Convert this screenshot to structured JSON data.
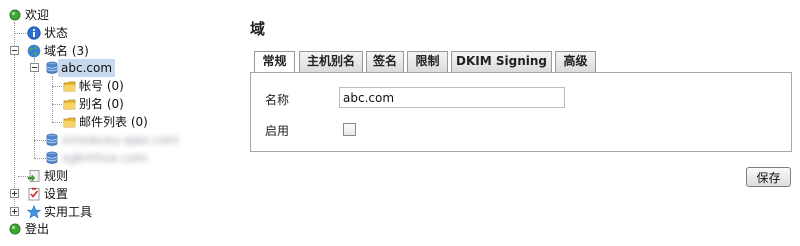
{
  "tree": {
    "welcome": "欢迎",
    "status": "状态",
    "domains": "域名 (3)",
    "selected_domain": "abc.com",
    "accounts": "帐号 (0)",
    "aliases": "别名 (0)",
    "mailing_lists": "邮件列表 (0)",
    "blurred_domain_1": "xmxwuxu-ajax.com",
    "blurred_domain_2": "xgkmhux.com",
    "rules": "规则",
    "settings": "设置",
    "utilities": "实用工具",
    "logout": "登出"
  },
  "page": {
    "title": "域",
    "tabs": [
      "常规",
      "主机别名",
      "签名",
      "限制",
      "DKIM Signing",
      "高级"
    ],
    "active_tab": "常规"
  },
  "form": {
    "name_label": "名称",
    "name_value": "abc.com",
    "enabled_label": "启用",
    "enabled": false,
    "save_label": "保存"
  },
  "colors": {
    "selection_bg": "#c8d8ee",
    "status_dot": "#3fa535",
    "info_icon": "#2a6fd1"
  },
  "icons": [
    "green-dot-icon",
    "info-icon",
    "globe-icon",
    "database-icon",
    "folder-icon",
    "rules-icon",
    "settings-icon",
    "star-icon"
  ]
}
